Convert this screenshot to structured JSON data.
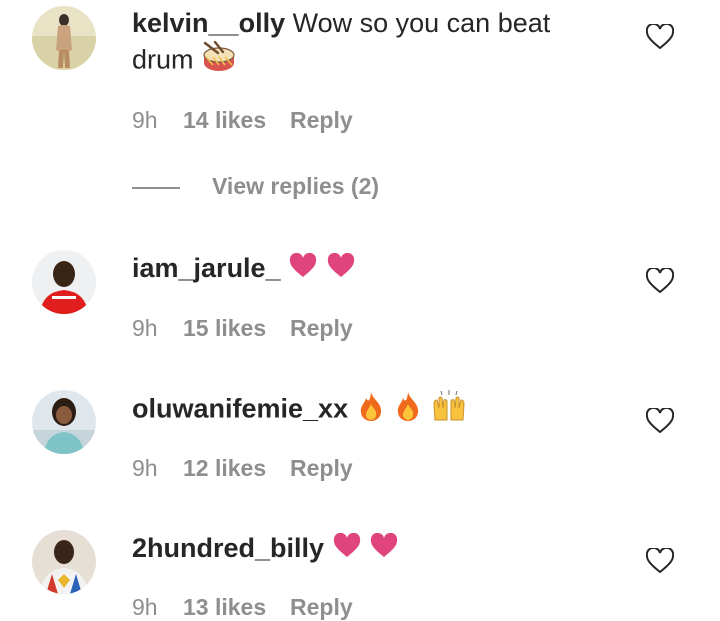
{
  "comments": [
    {
      "username": "kelvin__olly",
      "text": " Wow so you can beat",
      "text2": "drum",
      "time": "9h",
      "likes": "14 likes",
      "reply": "Reply",
      "view_replies": "View replies (2)",
      "emoji": [
        "drum-emoji"
      ]
    },
    {
      "username": "iam_jarule_",
      "text": "",
      "time": "9h",
      "likes": "15 likes",
      "reply": "Reply",
      "emoji": [
        "pink-heart-emoji",
        "pink-heart-emoji"
      ]
    },
    {
      "username": "oluwanifemie_xx",
      "text": "",
      "time": "9h",
      "likes": "12 likes",
      "reply": "Reply",
      "emoji": [
        "fire-emoji",
        "fire-emoji",
        "raising-hands-emoji"
      ]
    },
    {
      "username": "2hundred_billy",
      "text": "",
      "time": "9h",
      "likes": "13 likes",
      "reply": "Reply",
      "emoji": [
        "pink-heart-emoji",
        "pink-heart-emoji"
      ]
    }
  ],
  "colors": {
    "text": "#262626",
    "secondary": "#8e8e8e",
    "heart_emoji": "#e0447d"
  }
}
